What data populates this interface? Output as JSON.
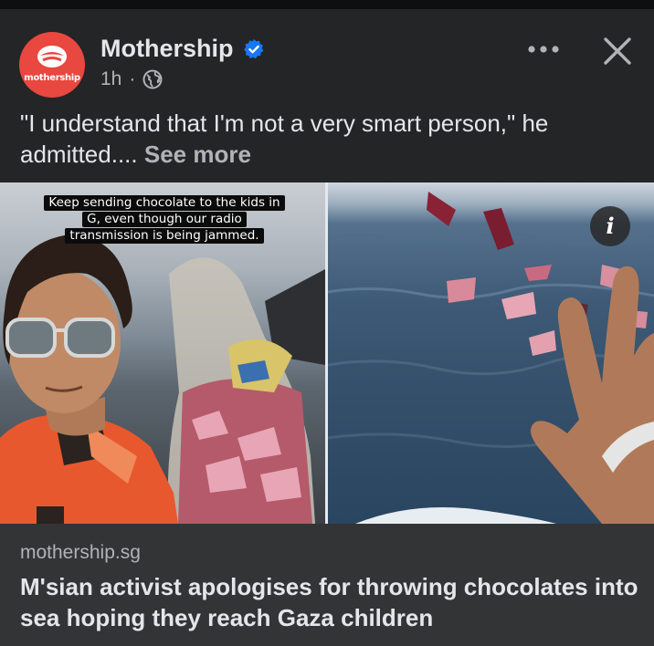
{
  "post": {
    "page_name": "Mothership",
    "avatar_text": "mothership",
    "verified_icon": "verified-badge-icon",
    "time": "1h",
    "separator": "·",
    "audience_icon": "globe-icon",
    "more_icon": "more-options-icon",
    "close_icon": "close-icon",
    "caption": "\"I understand that I'm not a very smart person,\" he admitted....",
    "see_more": "See more"
  },
  "media": {
    "overlay_lines": [
      "Keep sending chocolate to the kids in",
      "G, even though our radio",
      "transmission is being jammed."
    ],
    "info_label": "i"
  },
  "link": {
    "domain": "mothership.sg",
    "headline": "M'sian activist apologises for throwing chocolates into sea hoping they reach Gaza children"
  },
  "colors": {
    "background": "#242526",
    "link_footer": "#323436",
    "brand_red": "#e8483f",
    "verified_blue": "#1877f2",
    "text_primary": "#e4e6eb",
    "text_secondary": "#b0b3b8"
  }
}
